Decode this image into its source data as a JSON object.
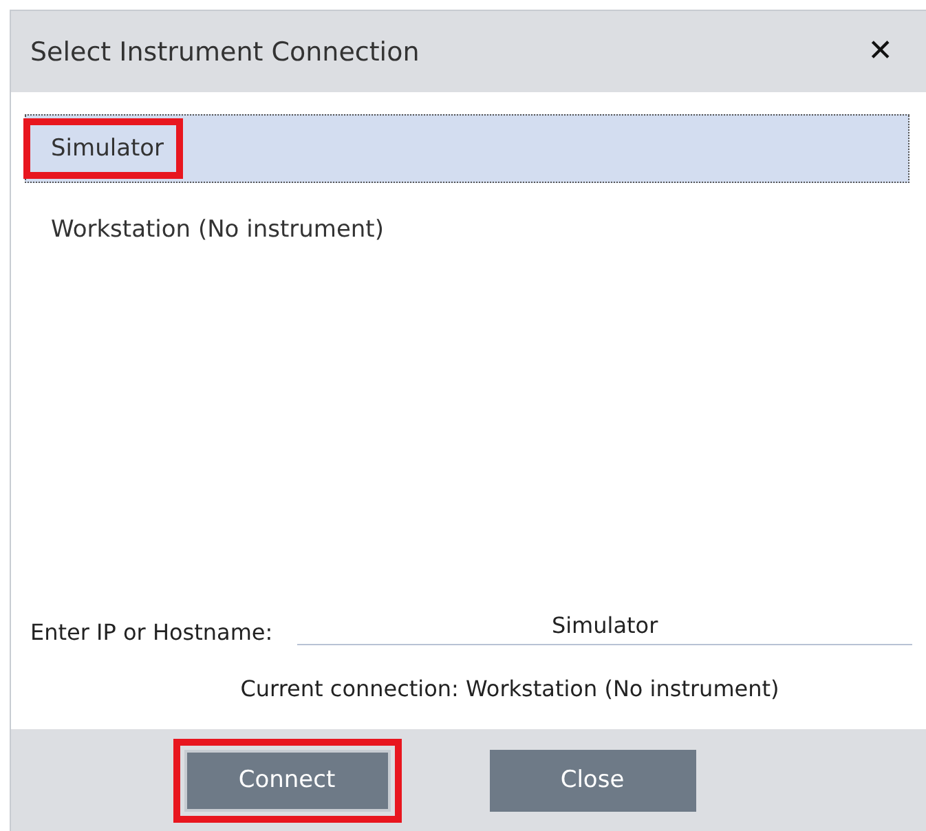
{
  "window": {
    "title": "Select Instrument Connection",
    "close_glyph": "✕"
  },
  "connections": [
    {
      "label": "Simulator",
      "selected": true,
      "highlighted": true
    },
    {
      "label": "Workstation (No instrument)",
      "selected": false,
      "highlighted": false
    }
  ],
  "host_field": {
    "label": "Enter IP or Hostname:",
    "value": "Simulator"
  },
  "current_connection": "Current connection: Workstation (No instrument)",
  "buttons": [
    {
      "label": "Connect",
      "highlighted": true
    },
    {
      "label": "Close",
      "highlighted": false
    }
  ]
}
